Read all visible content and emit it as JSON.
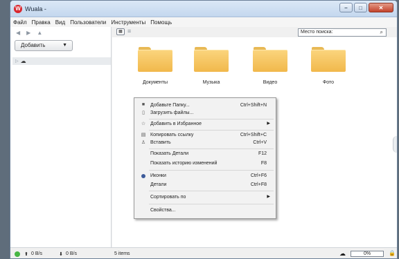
{
  "window": {
    "title": "Wuala -",
    "logo_letter": "W"
  },
  "menu": [
    "Файл",
    "Правка",
    "Вид",
    "Пользователи",
    "Инструменты",
    "Помощь"
  ],
  "sidebar": {
    "add_label": "Добавить"
  },
  "toolbar": {
    "search_placeholder": "Место поиска:"
  },
  "folders": [
    "Документы",
    "Музыка",
    "Видео",
    "Фото"
  ],
  "context_menu": {
    "add_folder": "Добавьте Папку...",
    "add_folder_sc": "Ctrl+Shift+N",
    "upload": "Загрузить файлы...",
    "favorites": "Добавить в Избранное",
    "copy_link": "Копировать ссылку",
    "copy_link_sc": "Ctrl+Shift+C",
    "paste": "Вставить",
    "paste_sc": "Ctrl+V",
    "details": "Показать Детали",
    "details_sc": "F12",
    "history": "Показать историю изменений",
    "history_sc": "F8",
    "icons": "Иконки",
    "icons_sc": "Ctrl+F6",
    "details_view": "Детали",
    "details_view_sc": "Ctrl+F8",
    "sort": "Сортировать по",
    "properties": "Свойства..."
  },
  "status": {
    "upload": "0 B/s",
    "download": "0 B/s",
    "items": "5 items",
    "progress": "0%"
  },
  "colors": {
    "folder": "#f1b84b",
    "status_ok": "#47b644",
    "close": "#c3432c"
  }
}
